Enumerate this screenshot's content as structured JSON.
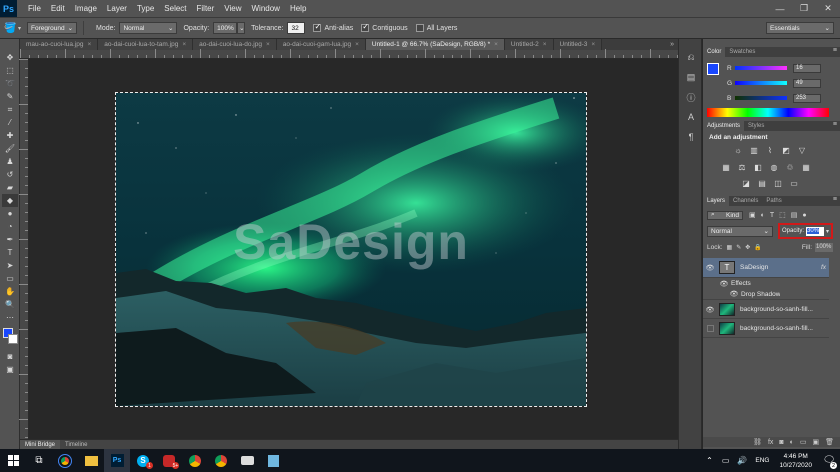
{
  "menubar": {
    "logo": "Ps",
    "items": [
      "File",
      "Edit",
      "Image",
      "Layer",
      "Type",
      "Select",
      "Filter",
      "View",
      "Window",
      "Help"
    ]
  },
  "options": {
    "fill_source": "Foreground",
    "mode_label": "Mode:",
    "mode_value": "Normal",
    "opacity_label": "Opacity:",
    "opacity_value": "100%",
    "tolerance_label": "Tolerance:",
    "tolerance_value": "32",
    "antialias_label": "Anti-alias",
    "contiguous_label": "Contiguous",
    "all_layers_label": "All Layers",
    "workspace": "Essentials"
  },
  "doc_tabs": [
    {
      "label": "mau-ao-cuoi-lua.jpg",
      "active": false
    },
    {
      "label": "ao-dai-cuoi-lua-to-tam.jpg",
      "active": false
    },
    {
      "label": "ao-dai-cuoi-lua-do.jpg",
      "active": false
    },
    {
      "label": "ao-dai-cuoi-gam-lua.jpg",
      "active": false
    },
    {
      "label": "Untitled-1 @ 66.7% (SaDesign, RGB/8) *",
      "active": true
    },
    {
      "label": "Untitled-2",
      "active": false
    },
    {
      "label": "Untitled-3",
      "active": false
    }
  ],
  "canvas": {
    "watermark": "SaDesign"
  },
  "bottom_tabs": [
    "Mini Bridge",
    "Timeline"
  ],
  "color_panel": {
    "tabs": [
      "Color",
      "Swatches"
    ],
    "foreground": "#1846fd",
    "r_label": "R",
    "r_value": "16",
    "g_label": "G",
    "g_value": "49",
    "b_label": "B",
    "b_value": "253"
  },
  "adjustments_panel": {
    "tabs": [
      "Adjustments",
      "Styles"
    ],
    "heading": "Add an adjustment"
  },
  "layers_panel": {
    "tabs": [
      "Layers",
      "Channels",
      "Paths"
    ],
    "filter_kind": "Kind",
    "blend_mode": "Normal",
    "opacity_label": "Opacity:",
    "opacity_value": "30%",
    "lock_label": "Lock:",
    "fill_label": "Fill:",
    "fill_value": "100%",
    "layers": [
      {
        "name": "SaDesign",
        "fx": "fx"
      },
      {
        "name": "Effects"
      },
      {
        "name": "Drop Shadow"
      },
      {
        "name": "background-so-sanh-fill..."
      },
      {
        "name": "background-so-sanh-fill..."
      }
    ]
  },
  "taskbar": {
    "language": "ENG",
    "time": "4:46 PM",
    "date": "10/27/2020",
    "notification_count": "2",
    "badges": {
      "skype": "1",
      "app": "5+"
    }
  }
}
